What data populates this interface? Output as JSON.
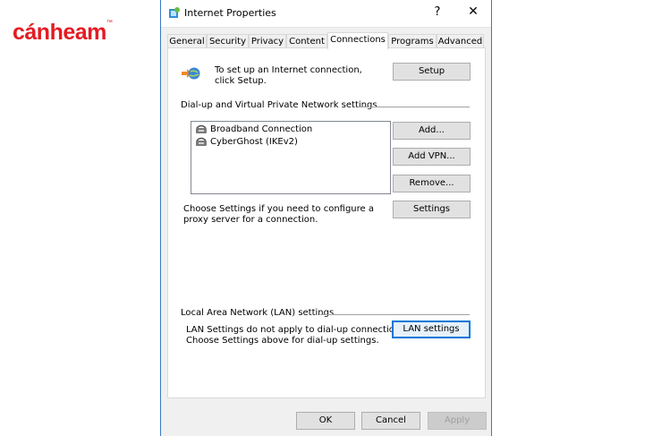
{
  "logo": {
    "text": "cánheam",
    "mark": "™"
  },
  "window": {
    "title": "Internet Properties",
    "help_glyph": "?",
    "close_glyph": "✕"
  },
  "tabs": [
    {
      "label": "General"
    },
    {
      "label": "Security"
    },
    {
      "label": "Privacy"
    },
    {
      "label": "Content"
    },
    {
      "label": "Connections",
      "active": true
    },
    {
      "label": "Programs"
    },
    {
      "label": "Advanced"
    }
  ],
  "setup": {
    "description": "To set up an Internet connection, click Setup.",
    "button": "Setup"
  },
  "dialup": {
    "heading": "Dial-up and Virtual Private Network settings",
    "connections": [
      {
        "name": "Broadband Connection"
      },
      {
        "name": "CyberGhost (IKEv2)"
      }
    ],
    "add_button": "Add...",
    "add_vpn_button": "Add VPN...",
    "remove_button": "Remove...",
    "settings_description": "Choose Settings if you need to configure a proxy server for a connection.",
    "settings_button": "Settings"
  },
  "lan": {
    "heading": "Local Area Network (LAN) settings",
    "description_line1": "LAN Settings do not apply to dial-up connections.",
    "description_line2": "Choose Settings above for dial-up settings.",
    "button": "LAN settings"
  },
  "footer": {
    "ok": "OK",
    "cancel": "Cancel",
    "apply": "Apply"
  },
  "colors": {
    "brand": "#e31b23",
    "accent": "#0078d7"
  }
}
